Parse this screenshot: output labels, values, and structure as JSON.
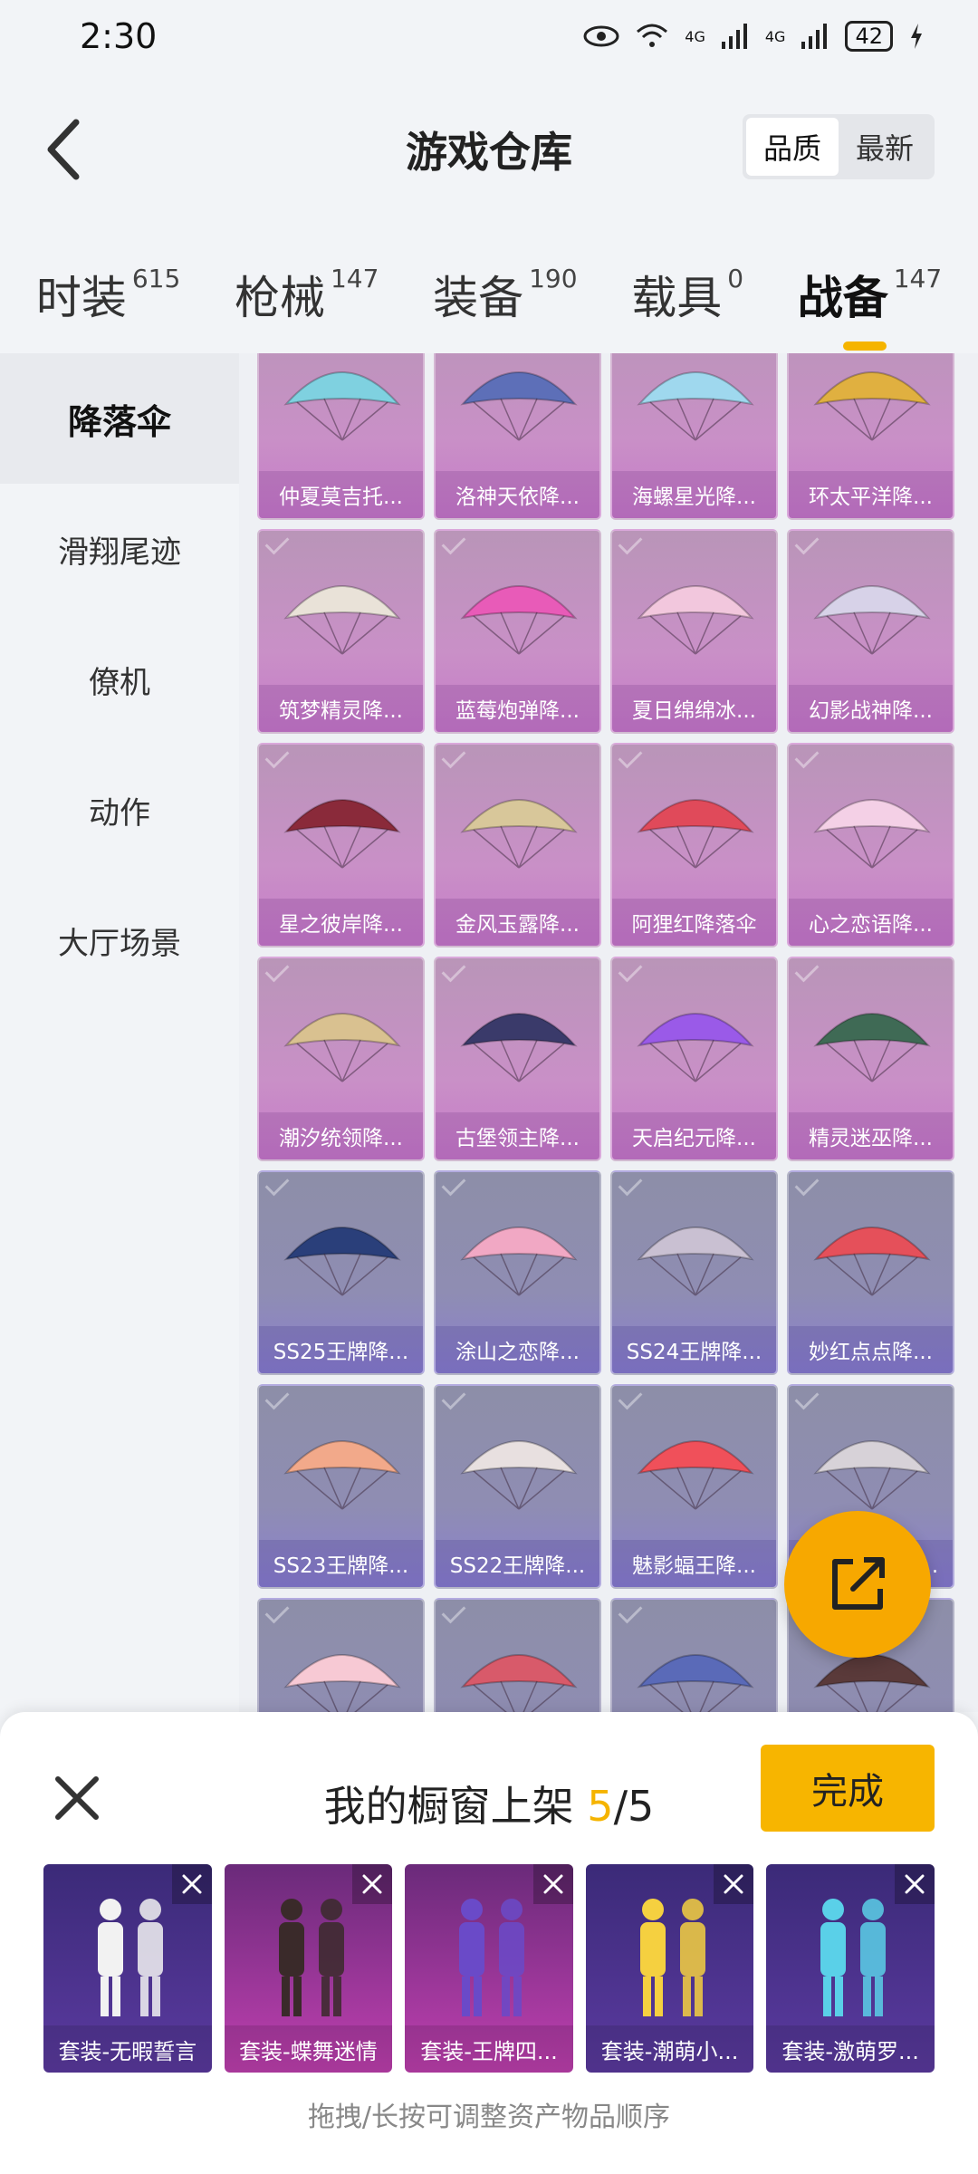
{
  "status_bar": {
    "time": "2:30",
    "battery": "42",
    "net1": "4G",
    "net2": "4G"
  },
  "header": {
    "title": "游戏仓库",
    "sort_quality": "品质",
    "sort_newest": "最新"
  },
  "tabs": [
    {
      "label": "时装",
      "count": "615"
    },
    {
      "label": "枪械",
      "count": "147"
    },
    {
      "label": "装备",
      "count": "190"
    },
    {
      "label": "载具",
      "count": "0"
    },
    {
      "label": "战备",
      "count": "147"
    }
  ],
  "side_menu": [
    "降落伞",
    "滑翔尾迹",
    "僚机",
    "动作",
    "大厅场景"
  ],
  "grid_items": [
    {
      "name": "仲夏莫吉托...",
      "tone": "pink",
      "color": "#7fd1e0"
    },
    {
      "name": "洛神天依降...",
      "tone": "pink",
      "color": "#5d6fb8"
    },
    {
      "name": "海螺星光降...",
      "tone": "pink",
      "color": "#9fd8ee"
    },
    {
      "name": "环太平洋降...",
      "tone": "pink",
      "color": "#e0b040"
    },
    {
      "name": "筑梦精灵降...",
      "tone": "pink",
      "color": "#e9e2d8"
    },
    {
      "name": "蓝莓炮弹降...",
      "tone": "pink",
      "color": "#e85bb8"
    },
    {
      "name": "夏日绵绵冰...",
      "tone": "pink",
      "color": "#f2c7dd"
    },
    {
      "name": "幻影战神降...",
      "tone": "pink",
      "color": "#d7d2e8"
    },
    {
      "name": "星之彼岸降...",
      "tone": "pink",
      "color": "#8a2a3a"
    },
    {
      "name": "金风玉露降...",
      "tone": "pink",
      "color": "#d8c79a"
    },
    {
      "name": "阿狸红降落伞",
      "tone": "pink",
      "color": "#e04a5a"
    },
    {
      "name": "心之恋语降...",
      "tone": "pink",
      "color": "#f4d0e6"
    },
    {
      "name": "潮汐统领降...",
      "tone": "pink",
      "color": "#d9c190"
    },
    {
      "name": "古堡领主降...",
      "tone": "pink",
      "color": "#3a3a6a"
    },
    {
      "name": "天启纪元降...",
      "tone": "pink",
      "color": "#9a5ae8"
    },
    {
      "name": "精灵迷巫降...",
      "tone": "pink",
      "color": "#3f6a55"
    },
    {
      "name": "SS25王牌降...",
      "tone": "blue",
      "color": "#2a3f7a"
    },
    {
      "name": "涂山之恋降...",
      "tone": "blue",
      "color": "#f1a8c4"
    },
    {
      "name": "SS24王牌降...",
      "tone": "blue",
      "color": "#c9c0d2"
    },
    {
      "name": "妙红点点降...",
      "tone": "blue",
      "color": "#e5505a"
    },
    {
      "name": "SS23王牌降...",
      "tone": "blue",
      "color": "#f2a98a"
    },
    {
      "name": "SS22王牌降...",
      "tone": "blue",
      "color": "#e8e0e0"
    },
    {
      "name": "魅影蝠王降...",
      "tone": "blue",
      "color": "#f0505a"
    },
    {
      "name": "SS21王牌降...",
      "tone": "blue",
      "color": "#d7d2d8"
    },
    {
      "name": "",
      "tone": "blue",
      "color": "#f7c9d4"
    },
    {
      "name": "",
      "tone": "blue",
      "color": "#d85a6a"
    },
    {
      "name": "",
      "tone": "blue",
      "color": "#5a6ab8"
    },
    {
      "name": "",
      "tone": "blue",
      "color": "#5a3a3a"
    }
  ],
  "showcase": {
    "title_prefix": "我的橱窗上架 ",
    "count_current": "5",
    "count_total": "/5",
    "done_label": "完成",
    "hint": "拖拽/长按可调整资产物品顺序",
    "items": [
      {
        "name": "套装-无暇誓言",
        "tone": "violet",
        "color": "#f2f2f2"
      },
      {
        "name": "套装-蝶舞迷情",
        "tone": "magenta",
        "color": "#3a2a2a"
      },
      {
        "name": "套装-王牌四...",
        "tone": "magenta",
        "color": "#6a4ac8"
      },
      {
        "name": "套装-潮萌小...",
        "tone": "violet",
        "color": "#f5d040"
      },
      {
        "name": "套装-激萌罗...",
        "tone": "violet",
        "color": "#5ad0e8"
      }
    ]
  },
  "colors": {
    "accent": "#f7b500",
    "fab": "#f7a800"
  }
}
